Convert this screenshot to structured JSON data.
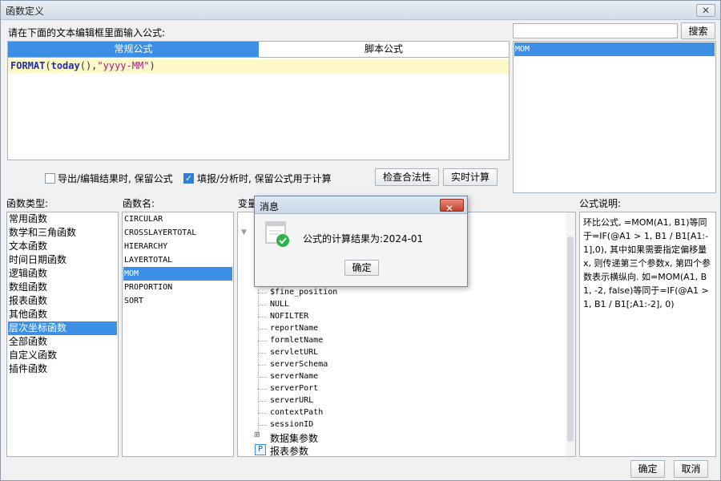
{
  "window": {
    "title": "函数定义",
    "close_icon": "close-icon"
  },
  "editor": {
    "instruction": "请在下面的文本编辑框里面输入公式:",
    "tabs": [
      {
        "label": "常规公式",
        "active": true
      },
      {
        "label": "脚本公式",
        "active": false
      }
    ],
    "formula": {
      "fn": "FORMAT",
      "open": "(",
      "inner_fn": "today",
      "inner_args": "()",
      "comma": ",",
      "arg": "\"yyyy-MM\"",
      "close": ")"
    }
  },
  "search": {
    "button_label": "搜索",
    "value": "",
    "results": [
      {
        "label": "MOM",
        "selected": true
      }
    ]
  },
  "options": {
    "keep_formula_export": {
      "label": "导出/编辑结果时, 保留公式",
      "checked": false
    },
    "keep_formula_fill": {
      "label": "填报/分析时, 保留公式用于计算",
      "checked": true
    },
    "check_button": "检查合法性",
    "realtime_button": "实时计算"
  },
  "function_types": {
    "header": "函数类型:",
    "items": [
      {
        "label": "常用函数",
        "selected": false
      },
      {
        "label": "数学和三角函数",
        "selected": false
      },
      {
        "label": "文本函数",
        "selected": false
      },
      {
        "label": "时间日期函数",
        "selected": false
      },
      {
        "label": "逻辑函数",
        "selected": false
      },
      {
        "label": "数组函数",
        "selected": false
      },
      {
        "label": "报表函数",
        "selected": false
      },
      {
        "label": "其他函数",
        "selected": false
      },
      {
        "label": "层次坐标函数",
        "selected": true
      },
      {
        "label": "全部函数",
        "selected": false
      },
      {
        "label": "自定义函数",
        "selected": false
      },
      {
        "label": "插件函数",
        "selected": false
      }
    ]
  },
  "function_names": {
    "header": "函数名:",
    "items": [
      {
        "label": "CIRCULAR",
        "selected": false
      },
      {
        "label": "CROSSLAYERTOTAL",
        "selected": false
      },
      {
        "label": "HIERARCHY",
        "selected": false
      },
      {
        "label": "LAYERTOTAL",
        "selected": false
      },
      {
        "label": "MOM",
        "selected": true
      },
      {
        "label": "PROPORTION",
        "selected": false
      },
      {
        "label": "SORT",
        "selected": false
      }
    ]
  },
  "variables": {
    "header": "变量",
    "items": [
      "$fine_position",
      "NULL",
      "NOFILTER",
      "reportName",
      "formletName",
      "servletURL",
      "serverSchema",
      "serverName",
      "serverPort",
      "serverURL",
      "contextPath",
      "sessionID"
    ],
    "groups": [
      {
        "label": "数据集参数",
        "icon": "dataset-param-icon"
      },
      {
        "label": "报表参数",
        "icon": "report-param-icon",
        "badge": "P"
      }
    ]
  },
  "description": {
    "header": "公式说明:",
    "text": "环比公式, =MOM(A1, B1)等同于=IF(@A1 > 1, B1 / B1[A1:-1],0), 其中如果需要指定偏移量x, 则传递第三个参数x, 第四个参数表示横纵向. 如=MOM(A1, B1, -2, false)等同于=IF(@A1 > 1, B1 / B1[;A1:-2], 0)"
  },
  "message_dialog": {
    "title": "消息",
    "message": "公式的计算结果为:2024-01",
    "ok_label": "确定",
    "icon": "success-check-icon"
  },
  "footer": {
    "ok_label": "确定",
    "cancel_label": "取消"
  },
  "colors": {
    "accent": "#3d8fe5",
    "highlight_line": "#fdf8c8",
    "success": "#2bb24c",
    "dialog_close": "#c6422b"
  }
}
